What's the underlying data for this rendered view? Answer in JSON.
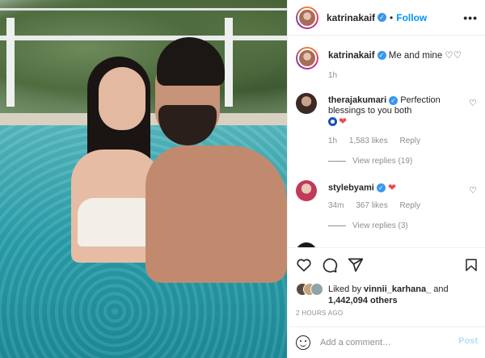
{
  "header": {
    "username": "katrinakaif",
    "separator": "•",
    "follow_label": "Follow",
    "more_icon": "more-horizontal-icon"
  },
  "caption": {
    "username": "katrinakaif",
    "text": "Me and mine ♡♡",
    "time": "1h"
  },
  "comments": [
    {
      "username": "therajakumari",
      "text": "Perfection blessings to you both",
      "time": "1h",
      "likes": "1,583 likes",
      "reply_label": "Reply",
      "view_replies": "View replies (19)"
    },
    {
      "username": "stylebyami",
      "time": "34m",
      "likes": "367 likes",
      "reply_label": "Reply",
      "view_replies": "View replies (3)"
    }
  ],
  "likes": {
    "prefix": "Liked by ",
    "user": "vinnii_karhana_",
    "and": " and",
    "others": "1,442,094 others"
  },
  "timestamp": "2 HOURS AGO",
  "add_comment": {
    "placeholder": "Add a comment…",
    "post_label": "Post"
  },
  "colors": {
    "accent": "#0095f6",
    "verified": "#3897f0",
    "heart": "#ed4956",
    "muted": "#8e8e8e"
  }
}
